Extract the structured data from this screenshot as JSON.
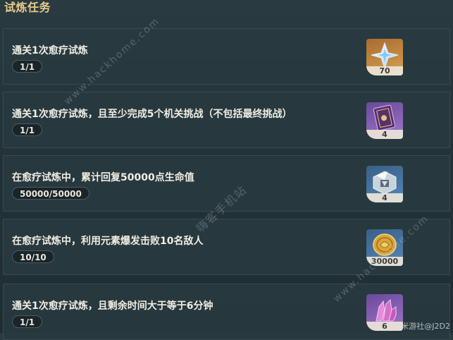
{
  "section": {
    "title": "试炼任务"
  },
  "tasks": [
    {
      "text": "通关1次愈疗试炼",
      "progress": "1/1",
      "reward": {
        "icon": "primogem-icon",
        "count": "70",
        "rarity_color": "#c58c45"
      }
    },
    {
      "text": "通关1次愈疗试炼，且至少完成5个机关挑战（不包括最终挑战）",
      "progress": "1/1",
      "reward": {
        "icon": "hero-wit-book-icon",
        "count": "4",
        "rarity_color": "#8a64b8"
      }
    },
    {
      "text": "在愈疗试炼中，累计回复50000点生命值",
      "progress": "50000/50000",
      "reward": {
        "icon": "enhancement-ore-icon",
        "count": "4",
        "rarity_color": "#4a77a3"
      }
    },
    {
      "text": "在愈疗试炼中，利用元素爆发击败10名敌人",
      "progress": "10/10",
      "reward": {
        "icon": "mora-coin-icon",
        "count": "30000",
        "rarity_color": "#4a77a3"
      }
    },
    {
      "text": "通关1次愈疗试炼，且剩余时间大于等于6分钟",
      "progress": "1/1",
      "reward": {
        "icon": "crystal-chunk-icon",
        "count": "6",
        "rarity_color": "#8a64b8"
      }
    }
  ],
  "watermarks": {
    "url_top": "www.hackhome.com",
    "cn": "嗨客手机站",
    "url_bottom": "www.hackhome.com"
  },
  "footer": {
    "credit": "米游社@J2D2"
  }
}
